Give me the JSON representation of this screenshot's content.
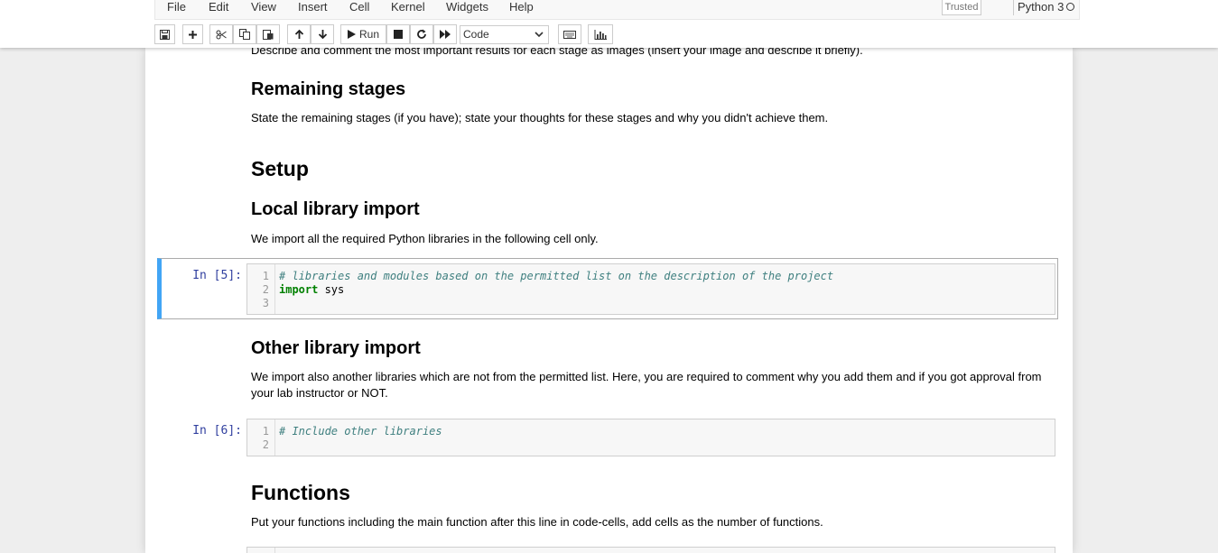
{
  "menubar": {
    "items": [
      "File",
      "Edit",
      "View",
      "Insert",
      "Cell",
      "Kernel",
      "Widgets",
      "Help"
    ],
    "trusted": "Trusted",
    "kernel": "Python 3"
  },
  "toolbar": {
    "run_label": "Run",
    "cell_type": "Code",
    "icons": [
      "save-icon",
      "plus-icon",
      "cut-icon",
      "copy-icon",
      "paste-icon",
      "arrow-up-icon",
      "arrow-down-icon",
      "play-icon",
      "stop-icon",
      "restart-icon",
      "fast-forward-icon",
      "chevron-down-icon",
      "keyboard-icon",
      "bar-chart-icon"
    ]
  },
  "notebook": {
    "top_text": "Describe and comment the most important results for each stage as images (insert your image and describe it briefly).",
    "remaining_heading": "Remaining stages",
    "remaining_text": "State the remaining stages (if you have); state your thoughts for these stages and why you didn't achieve them.",
    "setup_heading": "Setup",
    "local_heading": "Local library import",
    "local_text": "We import all the required Python libraries in the following cell only.",
    "cell5": {
      "prompt": "In [5]:",
      "line_numbers": [
        "1",
        "2",
        "3"
      ],
      "comment": "# libraries and modules based on the permitted list on the description of the project",
      "import_kw": "import",
      "import_mod": " sys"
    },
    "other_heading": "Other library import",
    "other_text": "We import also another libraries which are not from the permitted list. Here, you are required to comment why you add them and if you got approval from your lab instructor or NOT.",
    "cell6": {
      "prompt": "In [6]:",
      "line_numbers": [
        "1",
        "2"
      ],
      "comment": "# Include other libraries"
    },
    "functions_heading": "Functions",
    "functions_text": "Put your functions including the main function after this line in code-cells, add cells as the number of functions."
  },
  "colors": {
    "selected_cell_border": "#42a5f5",
    "prompt": "#303f9f",
    "comment": "#408080",
    "keyword": "#008000"
  }
}
